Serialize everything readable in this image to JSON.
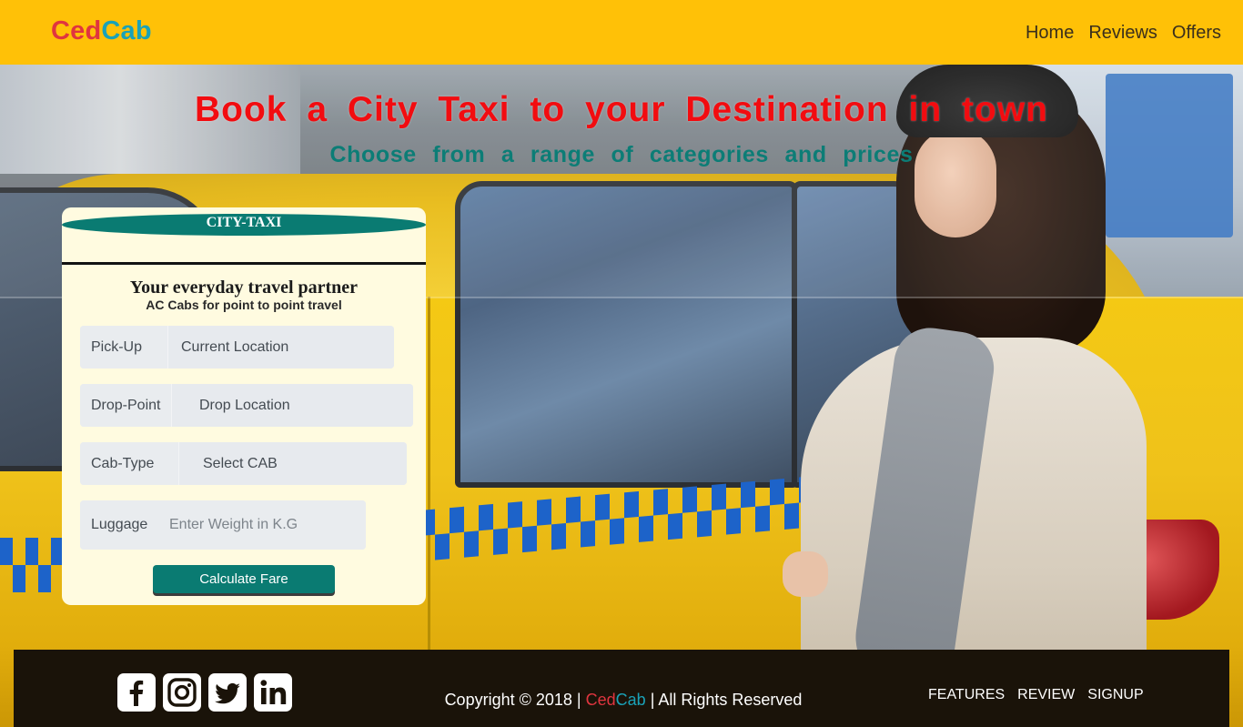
{
  "brand": {
    "part1": "Ced",
    "part2": "Cab",
    "color1": "#e0353f",
    "color2": "#1aa2b8"
  },
  "nav": {
    "items": [
      "Home",
      "Reviews",
      "Offers"
    ],
    "background": "#ffc107"
  },
  "hero": {
    "title": "Book a City Taxi to your Destination in town",
    "subtitle": "Choose from a range of categories and prices",
    "title_color": "#f20c10",
    "subtitle_color": "#0c7d76"
  },
  "booking": {
    "banner": "CITY-TAXI",
    "heading": "Your everyday travel partner",
    "subheading": "AC Cabs for point to point travel",
    "pickup": {
      "label": "Pick-Up",
      "value": "Current Location"
    },
    "drop": {
      "label": "Drop-Point",
      "value": "Drop Location"
    },
    "cab_type": {
      "label": "Cab-Type",
      "value": "Select CAB"
    },
    "luggage": {
      "label": "Luggage",
      "placeholder": "Enter Weight in K.G"
    },
    "submit_label": "Calculate Fare",
    "accent": "#0a7b72"
  },
  "footer": {
    "social_icons": [
      "facebook-icon",
      "instagram-icon",
      "twitter-icon",
      "linkedin-icon"
    ],
    "copyright_prefix": "Copyright © 2018 |",
    "brand_part1": "Ced",
    "brand_part2": "Cab",
    "copyright_suffix": "| All Rights Reserved",
    "links": [
      "FEATURES",
      "REVIEW",
      "SIGNUP"
    ]
  }
}
